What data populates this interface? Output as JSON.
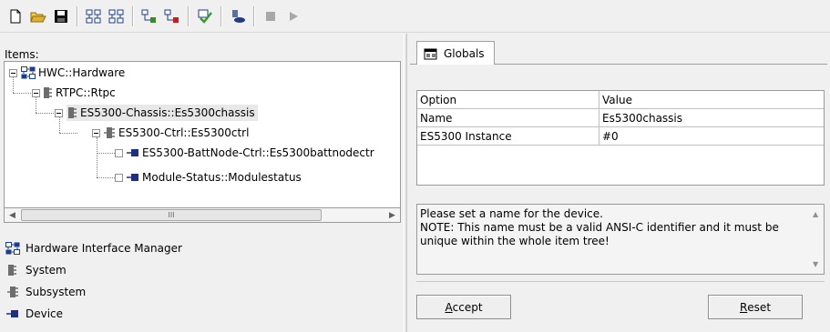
{
  "toolbar": {
    "buttons": [
      {
        "icon": "new-file-icon"
      },
      {
        "icon": "open-folder-icon"
      },
      {
        "icon": "save-icon"
      },
      {
        "icon": "hierarchy-icon"
      },
      {
        "icon": "hierarchy-remove-icon"
      },
      {
        "icon": "tree-add-icon"
      },
      {
        "icon": "tree-remove-icon"
      },
      {
        "icon": "check-icon"
      },
      {
        "icon": "build-icon"
      },
      {
        "icon": "stop-icon"
      },
      {
        "icon": "run-icon"
      }
    ]
  },
  "left": {
    "items_label": "Items:",
    "tree": [
      {
        "label": "HWC::Hardware",
        "icon": "hardware-icon"
      },
      {
        "label": "RTPC::Rtpc",
        "icon": "system-icon"
      },
      {
        "label": "ES5300-Chassis::Es5300chassis",
        "icon": "system-icon"
      },
      {
        "label": "ES5300-Ctrl::Es5300ctrl",
        "icon": "subsystem-icon"
      },
      {
        "label": "ES5300-BattNode-Ctrl::Es5300battnodectr",
        "icon": "device-icon"
      },
      {
        "label": "Module-Status::Modulestatus",
        "icon": "device-icon"
      }
    ],
    "scroll_thumb_grip": "III",
    "legend": [
      {
        "label": "Hardware Interface Manager",
        "icon": "hardware-icon"
      },
      {
        "label": "System",
        "icon": "system-icon"
      },
      {
        "label": "Subsystem",
        "icon": "subsystem-icon"
      },
      {
        "label": "Device",
        "icon": "device-icon"
      }
    ]
  },
  "right": {
    "tab_label": "Globals",
    "grid": {
      "headers": [
        "Option",
        "Value"
      ],
      "rows": [
        [
          "Name",
          "Es5300chassis"
        ],
        [
          "ES5300 Instance",
          "#0"
        ]
      ]
    },
    "message": "Please set a name for the device.\nNOTE: This name must be a valid ANSI-C identifier and it must be unique within the whole item tree!",
    "accept_first": "A",
    "accept_rest": "ccept",
    "reset_first": "R",
    "reset_rest": "eset"
  },
  "colors": {
    "hardware_blue": "#1a3d8f",
    "system_gray": "#6d6d6d",
    "device_navy": "#1f2f80",
    "selection": "#e8e8e8"
  }
}
